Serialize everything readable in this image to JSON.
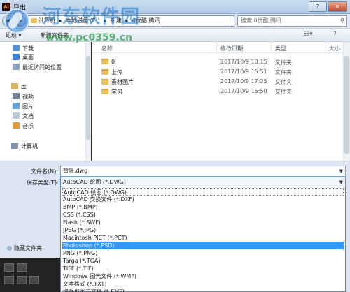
{
  "window": {
    "title": "导出"
  },
  "address": {
    "segments": [
      "计算机",
      "本地磁盘 (E:)",
      "新建",
      "0优酷 腾讯"
    ],
    "separator": "▸"
  },
  "search": {
    "placeholder": "搜索 0优酷 腾讯"
  },
  "toolbar": {
    "organize": "组织 ▾",
    "new_folder": "新建文件夹"
  },
  "sidebar": {
    "favorites": [
      "下载",
      "桌面",
      "最近访问的位置"
    ],
    "libraries_header": "库",
    "libraries": [
      "视频",
      "图片",
      "文档",
      "音乐"
    ],
    "computer": "计算机"
  },
  "columns": {
    "name": "名称",
    "modified": "修改日期",
    "type": "类型",
    "size": "大小"
  },
  "files": [
    {
      "name": "0",
      "modified": "2017/10/9 10:15",
      "type": "文件夹"
    },
    {
      "name": "上传",
      "modified": "2017/10/9 15:51",
      "type": "文件夹"
    },
    {
      "name": "素材图片",
      "modified": "2017/10/9 17:25",
      "type": "文件夹"
    },
    {
      "name": "学习",
      "modified": "2017/10/9 15:50",
      "type": "文件夹"
    }
  ],
  "form": {
    "filename_label": "文件名(N):",
    "filename_value": "背景.dwg",
    "filetype_label": "保存类型(T):",
    "filetype_value": "AutoCAD 绘图 (*.DWG)"
  },
  "filetype_options": [
    "AutoCAD 绘图 (*.DWG)",
    "AutoCAD 交换文件 (*.DXF)",
    "BMP (*.BMP)",
    "CSS (*.CSS)",
    "Flash (*.SWF)",
    "JPEG (*.JPG)",
    "Macintosh PICT (*.PCT)",
    "Photoshop (*.PSD)",
    "PNG (*.PNG)",
    "Targa (*.TGA)",
    "TIFF (*.TIF)",
    "Windows 图元文件 (*.WMF)",
    "文本格式 (*.TXT)",
    "增强型图元文件 (*.EMF)"
  ],
  "selected_option_index": 7,
  "hide_folders": "隐藏文件夹",
  "watermark": {
    "text": "河东软件园",
    "url": "www.pc0359.cn"
  },
  "colors": {
    "selection": "#3399ff",
    "titlebar": "#c9dcf0",
    "folder": "#e8c15d"
  }
}
